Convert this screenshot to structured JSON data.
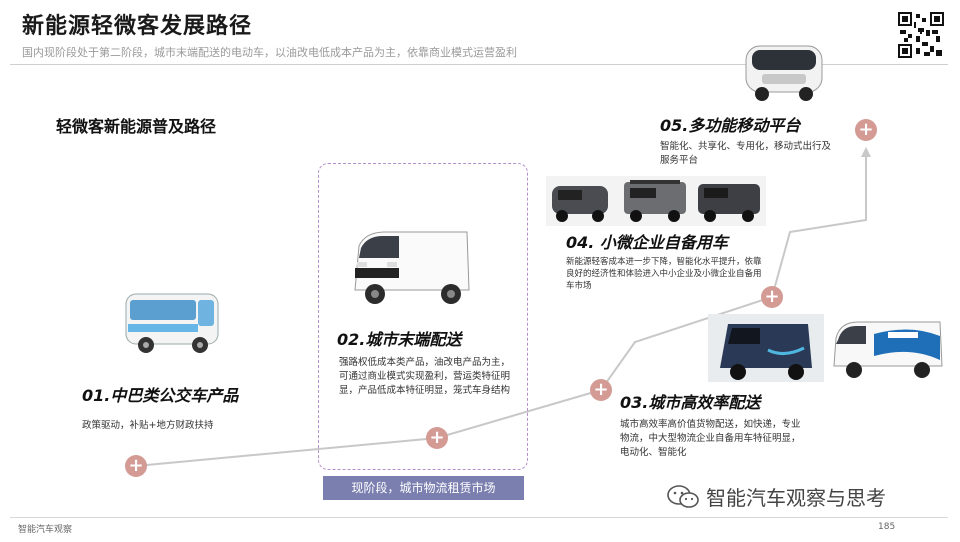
{
  "header": {
    "title": "新能源轻微客发展路径",
    "subtitle": "国内现阶段处于第二阶段，城市末端配送的电动车，以油改电低成本产品为主，依靠商业模式运营盈利"
  },
  "section_title": "轻微客新能源普及路径",
  "stages": [
    {
      "title": "01.中巴类公交车产品",
      "desc": "政策驱动，补贴+地方财政扶持"
    },
    {
      "title": "02.城市末端配送",
      "desc": "强路权低成本类产品，油改电产品为主，可通过商业模式实现盈利，营运类特征明显，产品低成本特征明显，笼式车身结构"
    },
    {
      "title": "03.城市高效率配送",
      "desc": "城市高效率高价值货物配送，如快递，专业物流，中大型物流企业自备用车特征明显，电动化、智能化"
    },
    {
      "title": "04. 小微企业自备用车",
      "desc": "新能源轻客成本进一步下降，智能化水平提升，依靠良好的经济性和体验进入中小企业及小微企业自备用车市场"
    },
    {
      "title": "05.多功能移动平台",
      "desc": "智能化、共享化、专用化，移动式出行及服务平台"
    }
  ],
  "banner": "现阶段，城市物流租赁市场",
  "node_symbol": "+",
  "footer": {
    "source": "智能汽车观察",
    "page": "185"
  },
  "watermark": "智能汽车观察与思考",
  "colors": {
    "node": "#d49a94",
    "path": "#c8c8c8",
    "banner": "#7b7fb0",
    "highlight_border": "#b58fc9"
  }
}
